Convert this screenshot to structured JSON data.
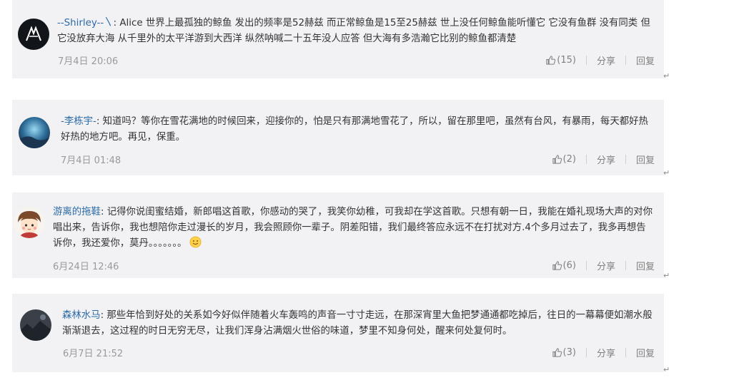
{
  "comments": [
    {
      "username": "--Shirley--〵",
      "text": "Alice 世界上最孤独的鲸鱼 发出的频率是52赫兹 而正常鲸鱼是15至25赫兹 世上没任何鲸鱼能听懂它 它没有鱼群 没有同类 但它没放弃大海 从千里外的太平洋游到大西洋 纵然呐喊二十五年没人应答 但大海有多浩瀚它比别的鲸鱼都清楚",
      "time": "7月4日 20:06",
      "likes": "(15)",
      "share": "分享",
      "reply": "回复"
    },
    {
      "username": "-李栋宇-",
      "text": "知道吗？等你在雪花满地的时候回来，迎接你的，怕是只有那满地雪花了，所以，留在那里吧，虽然有台风，有暴雨，每天都好热好热的地方吧。再见，保重。",
      "time": "7月4日 01:48",
      "likes": "(2)",
      "share": "分享",
      "reply": "回复"
    },
    {
      "username": "游离的拖鞋",
      "text": "记得你说闺蜜结婚，新郎唱这首歌，你感动的哭了，我笑你幼稚，可我却在学这首歌。只想有朝一日，我能在婚礼现场大声的对你唱出来，告诉你，我也想陪你走过漫长的岁月，我会照顾你一辈子。阴差阳错，我们最终答应永远不在打扰对方.4个多月过去了，我多再想告诉你，我还爱你，莫丹。。。。。。。",
      "time": "6月24日 12:46",
      "likes": "(6)",
      "share": "分享",
      "reply": "回复"
    },
    {
      "username": "森林水马",
      "text": "那些年恰到好处的关系如今好似伴随着火车轰鸣的声音一寸寸走远，在那深宵里大鱼把梦通通都吃掉后，往日的一幕幕便如潮水般渐渐退去，这过程的时日无穷无尽，让我们浑身沾满烟火世俗的味道，梦里不知身何处，醒来何处复何时。",
      "time": "6月7日 21:52",
      "likes": "(3)",
      "share": "分享",
      "reply": "回复"
    }
  ],
  "colon": ":",
  "paragraph_mark": "↵",
  "colors": {
    "card_bg": "#f2f2f5",
    "username": "#2b6aa6",
    "text": "#333333",
    "meta": "#9a9a9a"
  },
  "icons": [
    "like-icon",
    "smile-emoji-icon"
  ]
}
